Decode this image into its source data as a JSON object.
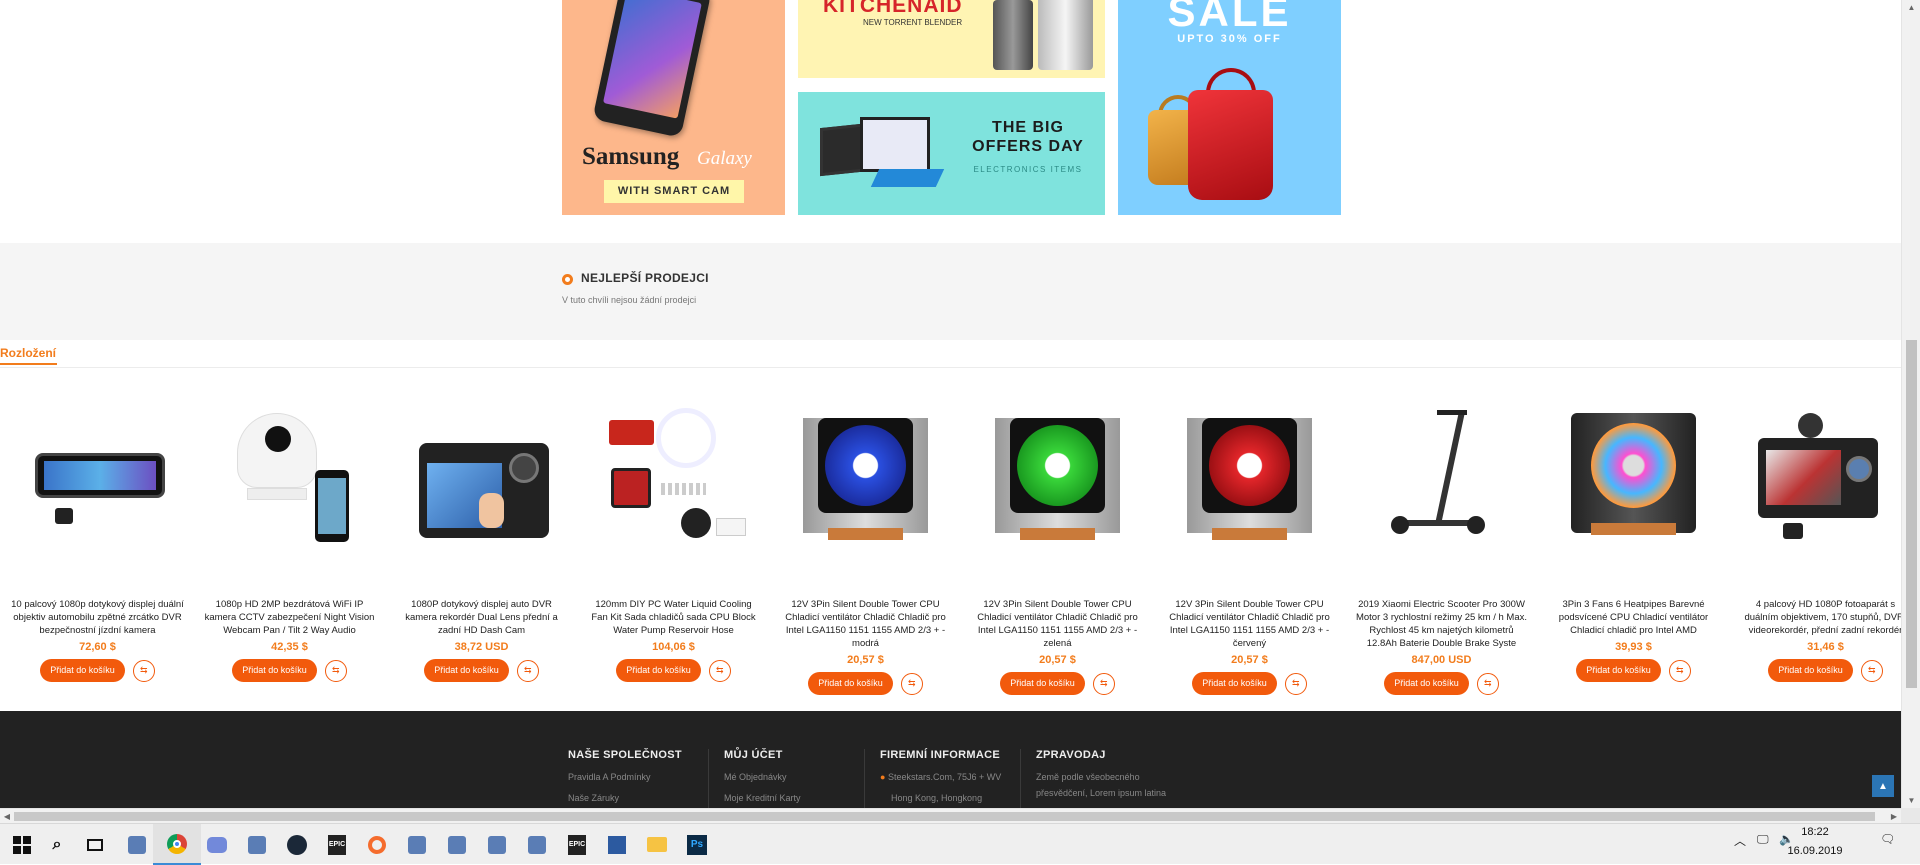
{
  "banners": {
    "samsung": {
      "brand": "Samsung",
      "model": "Galaxy",
      "tagline": "WITH SMART CAM"
    },
    "kitchenaid": {
      "brand": "KITCHENAID",
      "tagline": "NEW TORRENT BLENDER"
    },
    "offers": {
      "title_line1": "THE BIG",
      "title_line2": "OFFERS DAY",
      "subtitle": "ELECTRONICS ITEMS"
    },
    "sale": {
      "title": "SALE",
      "subtitle": "UPTO 30% OFF"
    }
  },
  "bestsellers": {
    "title": "NEJLEPŠÍ PRODEJCI",
    "empty_text": "V tuto chvíli nejsou žádní prodejci"
  },
  "layout_tab": {
    "label": "Rozložení"
  },
  "products": [
    {
      "name": "10 palcový 1080p dotykový displej duální objektiv automobilu zpětné zrcátko DVR bezpečnostní jízdní kamera",
      "price": "72,60 $",
      "icon": "mirror-dashcam-image"
    },
    {
      "name": "1080p HD 2MP bezdrátová WiFi IP kamera CCTV zabezpečení Night Vision Webcam Pan / Tilt 2 Way Audio",
      "price": "42,35 $",
      "icon": "ip-camera-image"
    },
    {
      "name": "1080P dotykový displej auto DVR kamera rekordér Dual Lens přední a zadní HD Dash Cam",
      "price": "38,72 USD",
      "icon": "dash-cam-image"
    },
    {
      "name": "120mm DIY PC Water Liquid Cooling Fan Kit Sada chladičů sada CPU Block Water Pump Reservoir Hose",
      "price": "104,06 $",
      "icon": "cooling-kit-image"
    },
    {
      "name": "12V 3Pin Silent Double Tower CPU Chladicí ventilátor Chladič Chladič pro Intel LGA1150 1151 1155 AMD 2/3 + - modrá",
      "price": "20,57 $",
      "icon": "cpu-cooler-blue-image"
    },
    {
      "name": "12V 3Pin Silent Double Tower CPU Chladicí ventilátor Chladič Chladič pro Intel LGA1150 1151 1155 AMD 2/3 + - zelená",
      "price": "20,57 $",
      "icon": "cpu-cooler-green-image"
    },
    {
      "name": "12V 3Pin Silent Double Tower CPU Chladicí ventilátor Chladič Chladič pro Intel LGA1150 1151 1155 AMD 2/3 + - červený",
      "price": "20,57 $",
      "icon": "cpu-cooler-red-image"
    },
    {
      "name": "2019 Xiaomi Electric Scooter Pro 300W Motor 3 rychlostní režimy 25 km / h Max. Rychlost 45 km najetých kilometrů 12.8Ah Baterie Double Brake Syste",
      "price": "847,00 USD",
      "icon": "scooter-image"
    },
    {
      "name": "3Pin 3 Fans 6 Heatpipes Barevné podsvícené CPU Chladicí ventilátor Chladicí chladič pro Intel AMD",
      "price": "39,93 $",
      "icon": "rgb-cooler-image"
    },
    {
      "name": "4 palcový HD 1080P fotoaparát s duálním objektivem, 170 stupňů, DVR, videorekordér, přední zadní rekordér",
      "price": "31,46 $",
      "icon": "dual-dashcam-image"
    }
  ],
  "cart_label": "Přidat do košíku",
  "compare_icon": "compare-icon",
  "footer": {
    "col1": {
      "title": "NAŠE SPOLEČNOST",
      "links": [
        "Pravidla A Podmínky",
        "Naše Záruky"
      ]
    },
    "col2": {
      "title": "MŮJ ÚČET",
      "links": [
        "Mé Objednávky",
        "Moje Kreditní Karty"
      ]
    },
    "col3": {
      "title": "FIREMNÍ INFORMACE",
      "links": [
        "Steekstars.Com, 75J6 + WV",
        "Hong Kong, Hongkong"
      ]
    },
    "col4": {
      "title": "ZPRAVODAJ",
      "links": [
        "Země podle všeobecného",
        "přesvědčení, Lorem ipsum latina"
      ]
    }
  },
  "taskbar": {
    "time": "18:22",
    "date": "16.09.2019",
    "apps": [
      "windows-start-icon",
      "search-icon",
      "task-view-icon",
      "app-icon",
      "chrome-icon",
      "discord-icon",
      "app-icon",
      "steam-icon",
      "epic-games-icon",
      "origin-icon",
      "app-icon",
      "app-icon",
      "app-icon",
      "app-icon",
      "epic-games-icon",
      "save-icon",
      "folder-icon",
      "photoshop-icon"
    ]
  },
  "colors": {
    "accent": "#f27c1c",
    "button": "#f25a0c",
    "footer_bg": "#222222",
    "taskbar_bg": "#efefef"
  }
}
